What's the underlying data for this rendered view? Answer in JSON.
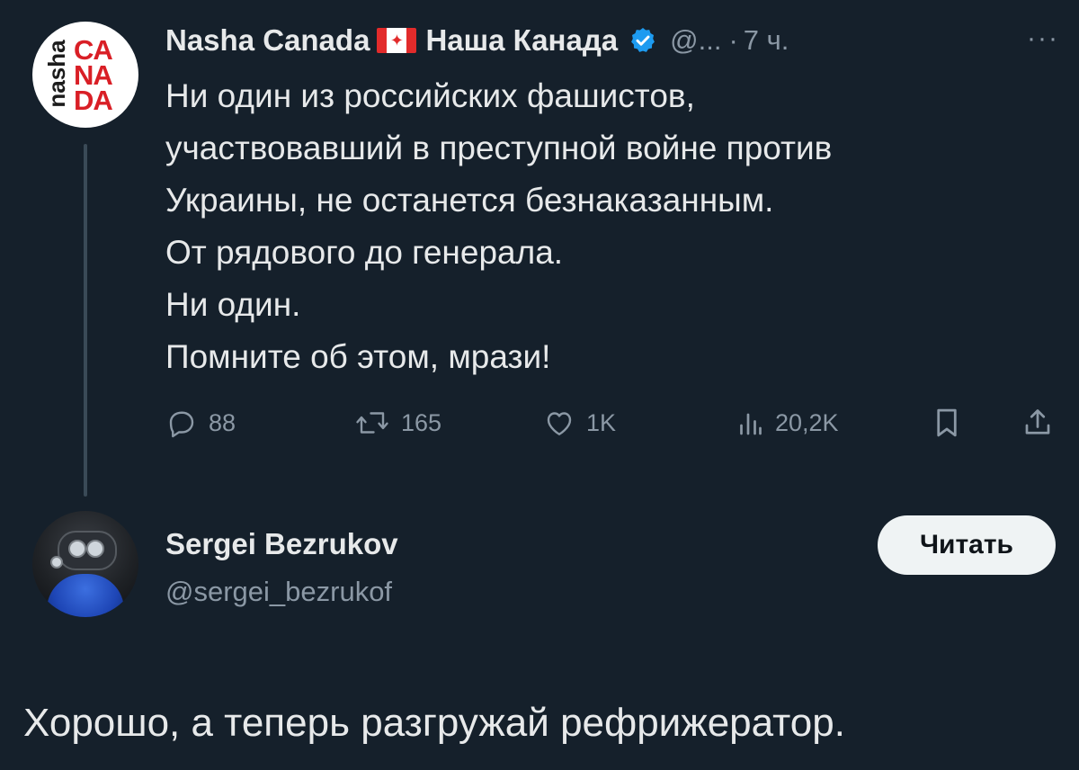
{
  "tweet": {
    "author": {
      "display_name": "Nasha Canada",
      "flag_icon": "canada-flag-icon",
      "display_name_cyr": "Наша Канада",
      "verified_icon": "verified-badge-icon",
      "handle": "@...",
      "separator": "·",
      "time": "7 ч.",
      "avatar": {
        "vertical_word": "nasha",
        "stack": [
          "CA",
          "NA",
          "DA"
        ]
      }
    },
    "more_icon": "···",
    "body_lines": [
      "Ни один из российских фашистов,",
      "участвовавший в преступной войне против",
      "Украины, не останется безнаказанным.",
      "От рядового до генерала.",
      "Ни один.",
      "Помните об этом, мрази!"
    ],
    "actions": {
      "reply_count": "88",
      "retweet_count": "165",
      "like_count": "1K",
      "views_count": "20,2K"
    }
  },
  "follow_card": {
    "display_name": "Sergei Bezrukov",
    "handle": "@sergei_bezrukof",
    "follow_label": "Читать"
  },
  "reply_text": "Хорошо, а теперь разгружай рефрижератор.",
  "colors": {
    "background": "#15202b",
    "text": "#e7e9ea",
    "muted": "#8b98a5",
    "verified": "#1d9bf0",
    "button_bg": "#eff3f4"
  }
}
